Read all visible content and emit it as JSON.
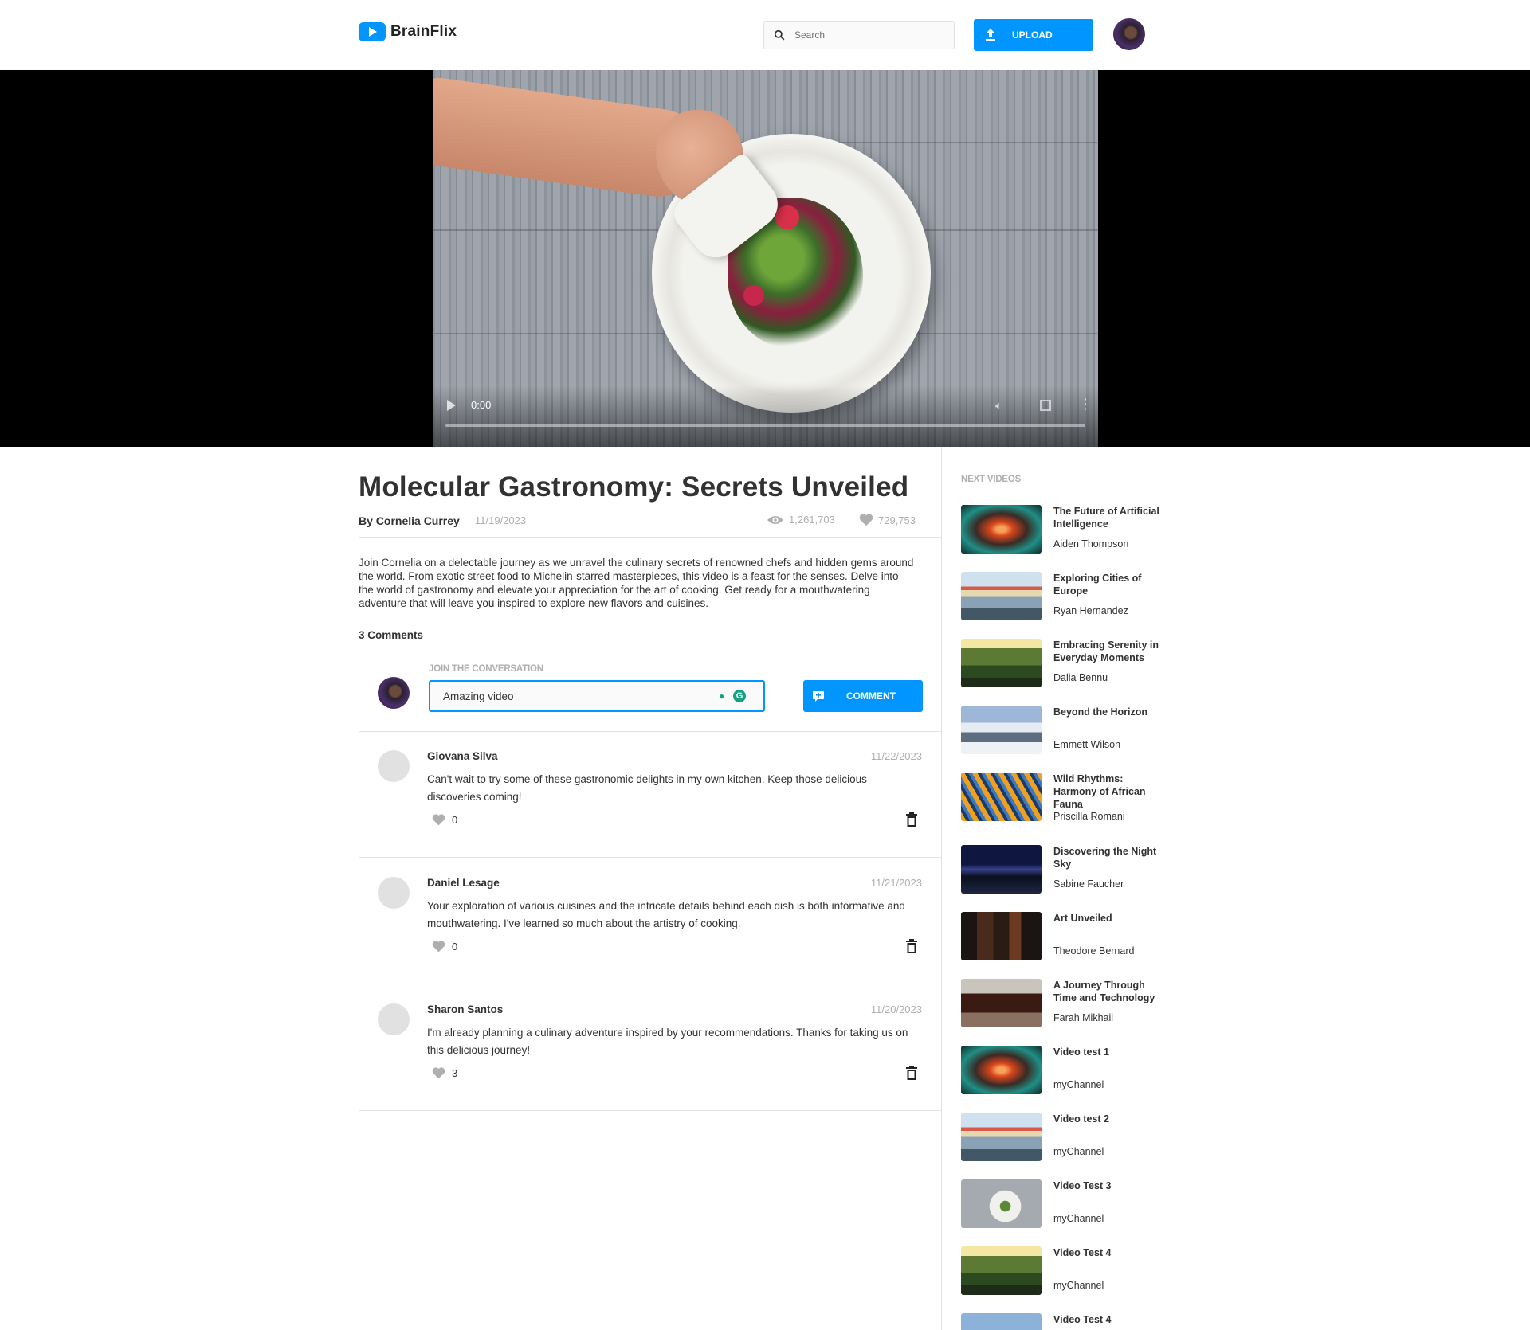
{
  "header": {
    "logo_text": "BrainFlix",
    "search_placeholder": "Search",
    "upload_label": "UPLOAD"
  },
  "video": {
    "time": "0:00",
    "progress": 0
  },
  "main": {
    "title": "Molecular Gastronomy: Secrets Unveiled",
    "author": "By Cornelia Currey",
    "date": "11/19/2023",
    "views": "1,261,703",
    "likes": "729,753",
    "description": "Join Cornelia on a delectable journey as we unravel the culinary secrets of renowned chefs and hidden gems around the world. From exotic street food to Michelin-starred masterpieces, this video is a feast for the senses. Delve into the world of gastronomy and elevate your appreciation for the art of cooking. Get ready for a mouthwatering adventure that will leave you inspired to explore new flavors and cuisines.",
    "comments_count": "3 Comments"
  },
  "comment_form": {
    "label": "JOIN THE CONVERSATION",
    "value": "Amazing video",
    "button_label": "COMMENT"
  },
  "comments": [
    {
      "name": "Giovana Silva",
      "date": "11/22/2023",
      "text": "Can't wait to try some of these gastronomic delights in my own kitchen. Keep those delicious discoveries coming!",
      "likes": "0"
    },
    {
      "name": "Daniel Lesage",
      "date": "11/21/2023",
      "text": "Your exploration of various cuisines and the intricate details behind each dish is both informative and mouthwatering. I've learned so much about the artistry of cooking.",
      "likes": "0"
    },
    {
      "name": "Sharon Santos",
      "date": "11/20/2023",
      "text": "I'm already planning a culinary adventure inspired by your recommendations. Thanks for taking us on this delicious journey!",
      "likes": "3"
    }
  ],
  "sidebar": {
    "label": "NEXT VIDEOS",
    "videos": [
      {
        "title": "The Future of Artificial Intelligence",
        "channel": "Aiden Thompson"
      },
      {
        "title": "Exploring Cities of Europe",
        "channel": "Ryan Hernandez"
      },
      {
        "title": "Embracing Serenity in Everyday Moments",
        "channel": "Dalia Bennu"
      },
      {
        "title": "Beyond the Horizon",
        "channel": "Emmett Wilson"
      },
      {
        "title": "Wild Rhythms: Harmony of African Fauna",
        "channel": "Priscilla Romani"
      },
      {
        "title": "Discovering the Night Sky",
        "channel": "Sabine Faucher"
      },
      {
        "title": "Art Unveiled",
        "channel": "Theodore Bernard"
      },
      {
        "title": "A Journey Through Time and Technology",
        "channel": "Farah Mikhail"
      },
      {
        "title": "Video test 1",
        "channel": "myChannel"
      },
      {
        "title": "Video test 2",
        "channel": "myChannel"
      },
      {
        "title": "Video Test 3",
        "channel": "myChannel"
      },
      {
        "title": "Video Test 4",
        "channel": "myChannel"
      },
      {
        "title": "Video Test 4",
        "channel": ""
      }
    ]
  },
  "colors": {
    "accent": "#0095ff",
    "text": "#323232",
    "muted": "#afafaf",
    "border": "#e1e1e1"
  }
}
